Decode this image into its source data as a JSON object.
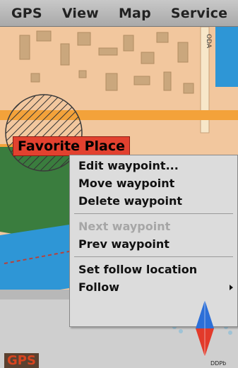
{
  "menubar": {
    "items": [
      "GPS",
      "View",
      "Map",
      "Service"
    ]
  },
  "map": {
    "place_label": "Favorite Place",
    "street_label": "ODA",
    "gps_badge": "GPS",
    "scale_text": "DDPb"
  },
  "context_menu": {
    "items": [
      {
        "label": "Edit waypoint...",
        "enabled": true
      },
      {
        "label": "Move waypoint",
        "enabled": true
      },
      {
        "label": "Delete waypoint",
        "enabled": true
      },
      {
        "label": "Next waypoint",
        "enabled": false
      },
      {
        "label": "Prev waypoint",
        "enabled": true
      },
      {
        "label": "Set follow location",
        "enabled": true
      },
      {
        "label": "Follow",
        "enabled": true,
        "has_submenu": true
      }
    ]
  },
  "colors": {
    "map_base": "#f2c79e",
    "building": "#caa77d",
    "road": "#f3a23a",
    "water": "#2e96d6",
    "park": "#3a7d3e",
    "highlight_label": "#e2412f",
    "menu_bg": "#dcdcdc"
  },
  "icons": [
    "north-arrow-icon",
    "submenu-arrow-icon"
  ]
}
